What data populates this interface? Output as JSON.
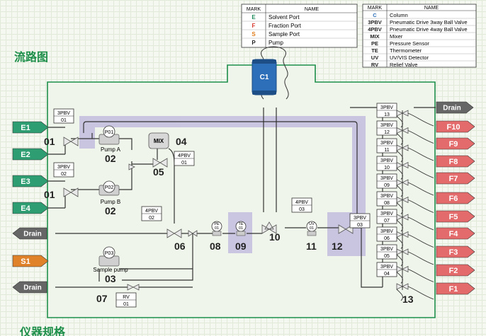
{
  "heading_top": "流路图",
  "heading_bottom": "仪器规格",
  "legend_left": {
    "col_mark": "MARK",
    "col_name": "NAME",
    "rows": [
      {
        "mark": "E",
        "name": "Solvent Port",
        "color": "#1f8a5a"
      },
      {
        "mark": "F",
        "name": "Fraction Port",
        "color": "#d83a2e"
      },
      {
        "mark": "S",
        "name": "Sample Port",
        "color": "#e07a16"
      },
      {
        "mark": "P",
        "name": "Pump",
        "color": "#222222"
      }
    ]
  },
  "legend_right": {
    "col_mark": "MARK",
    "col_name": "NAME",
    "rows": [
      {
        "mark": "C",
        "name": "Column",
        "color": "#2d6fb8"
      },
      {
        "mark": "3PBV",
        "name": "Pneumatic Drive 3way Ball Valve",
        "color": "#222222"
      },
      {
        "mark": "4PBV",
        "name": "Pneumatic Drive 4way Ball Valve",
        "color": "#222222"
      },
      {
        "mark": "MIX",
        "name": "Mixer",
        "color": "#222222"
      },
      {
        "mark": "PE",
        "name": "Pressure Sensor",
        "color": "#222222"
      },
      {
        "mark": "TE",
        "name": "Thermometer",
        "color": "#222222"
      },
      {
        "mark": "UV",
        "name": "UV/VIS Detector",
        "color": "#222222"
      },
      {
        "mark": "RV",
        "name": "Relief Valve",
        "color": "#222222"
      }
    ]
  },
  "ports_left": [
    {
      "id": "e1",
      "label": "E1"
    },
    {
      "id": "e2",
      "label": "E2"
    },
    {
      "id": "e3",
      "label": "E3"
    },
    {
      "id": "e4",
      "label": "E4"
    },
    {
      "id": "drain1",
      "label": "Drain"
    },
    {
      "id": "s1",
      "label": "S1"
    },
    {
      "id": "drain2",
      "label": "Drain"
    }
  ],
  "ports_right": [
    {
      "id": "drain3",
      "label": "Drain"
    },
    {
      "id": "f10",
      "label": "F10"
    },
    {
      "id": "f9",
      "label": "F9"
    },
    {
      "id": "f8",
      "label": "F8"
    },
    {
      "id": "f7",
      "label": "F7"
    },
    {
      "id": "f6",
      "label": "F6"
    },
    {
      "id": "f5",
      "label": "F5"
    },
    {
      "id": "f4",
      "label": "F4"
    },
    {
      "id": "f3",
      "label": "F3"
    },
    {
      "id": "f2",
      "label": "F2"
    },
    {
      "id": "f1",
      "label": "F1"
    }
  ],
  "tags": {
    "v01a": [
      "3PBV",
      "01"
    ],
    "v01b": [
      "3PBV",
      "02"
    ],
    "v05": [
      "4PBV",
      "01"
    ],
    "v06": [
      "4PBV",
      "02"
    ],
    "v10": [
      "4PBV",
      "03"
    ],
    "v12": [
      "3PBV",
      "03"
    ],
    "rv": [
      "RV",
      "01"
    ],
    "v13": [
      [
        "3PBV",
        "13"
      ],
      [
        "3PBV",
        "12"
      ],
      [
        "3PBV",
        "11"
      ],
      [
        "3PBV",
        "10"
      ],
      [
        "3PBV",
        "09"
      ],
      [
        "3PBV",
        "08"
      ],
      [
        "3PBV",
        "07"
      ],
      [
        "3PBV",
        "06"
      ],
      [
        "3PBV",
        "05"
      ],
      [
        "3PBV",
        "04"
      ]
    ]
  },
  "components": {
    "pump_a_id": "P01",
    "pump_a_label": "Pump A",
    "pump_b_id": "P02",
    "pump_b_label": "Pump B",
    "pump_s_id": "P03",
    "pump_s_label": "Sample pump",
    "mixer": "MIX",
    "column": "C1",
    "pe": "PE",
    "pe_num": "01",
    "te": "TE",
    "te_num": "01",
    "uv": "UV",
    "uv_num": "01"
  },
  "numbers": {
    "n01a": "01",
    "n01b": "01",
    "n02a": "02",
    "n02b": "02",
    "n03": "03",
    "n04": "04",
    "n05": "05",
    "n06": "06",
    "n07": "07",
    "n08": "08",
    "n09": "09",
    "n10": "10",
    "n11": "11",
    "n12": "12",
    "n13": "13"
  }
}
